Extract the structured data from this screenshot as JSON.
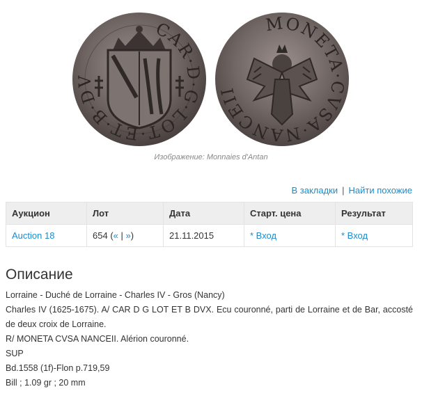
{
  "image": {
    "credit": "Изображение: Monnaies d'Antan",
    "obverse_legend": "CAR·D·G·LOT·ET·B·DVX",
    "reverse_legend": "MONETA·CVSA·NANCEII"
  },
  "actions": {
    "bookmark": "В закладки",
    "separator": "|",
    "similar": "Найти похожие"
  },
  "table": {
    "headers": [
      "Аукцион",
      "Лот",
      "Дата",
      "Старт. цена",
      "Результат"
    ],
    "row": {
      "auction": "Auction 18",
      "lot": "654",
      "lot_open": " (",
      "prev": "«",
      "lot_sep": " | ",
      "next": "»",
      "lot_close": ")",
      "date": "21.11.2015",
      "start_price": "* Вход",
      "result": "* Вход"
    }
  },
  "description": {
    "title": "Описание",
    "lines": [
      "Lorraine - Duché de Lorraine - Charles IV - Gros (Nancy)",
      "Charles IV (1625-1675). A/ CAR D G LOT ET B DVX. Ecu couronné, parti de Lorraine et de Bar, accosté de deux croix de Lorraine.",
      "R/ MONETA CVSA NANCEII. Alérion couronné.",
      "SUP",
      "Bd.1558 (1f)-Flon p.719,59",
      "Bill ; 1.09 gr ; 20 mm"
    ]
  }
}
